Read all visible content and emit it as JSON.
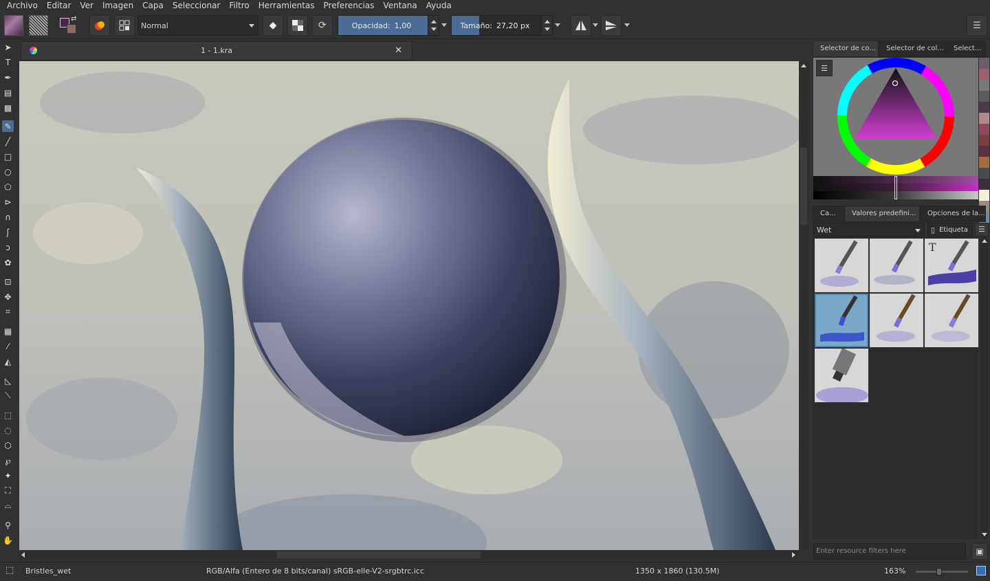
{
  "menu": [
    "Archivo",
    "Editar",
    "Ver",
    "Imagen",
    "Capa",
    "Seleccionar",
    "Filtro",
    "Herramientas",
    "Preferencias",
    "Ventana",
    "Ayuda"
  ],
  "toolbar": {
    "blend_mode": "Normal",
    "opacity_label": "Opacidad:",
    "opacity_value": "1,00",
    "opacity_fraction": 1.0,
    "size_label": "Tamaño:",
    "size_value": "27,20 px",
    "foreground_color": "#4a2848",
    "background_color": "#8d6a64"
  },
  "document": {
    "tab_title": "1 - 1.kra"
  },
  "dock": {
    "top_tabs": [
      "Selector de co...",
      "Selector de col...",
      "Select..."
    ],
    "bottom_tabs": [
      "Ca...",
      "Valores predefini...",
      "Opciones de la..."
    ],
    "preset_filter": "Wet",
    "tag_label": "Etiqueta",
    "search_placeholder": "Enter resource filters here",
    "palette_colors": [
      "#6d5a6b",
      "#a05f6f",
      "#7a7a7a",
      "#5b5b5b",
      "#4a3a48",
      "#b08a8a",
      "#8a4b5a",
      "#7a3f3f",
      "#5a2f3f",
      "#a36e3f",
      "#4a4a4a",
      "#3a2f3a",
      "#f5f0d7",
      "#9a8a7a",
      "#6a8aa6"
    ]
  },
  "status": {
    "brush": "Bristles_wet",
    "color_space": "RGB/Alfa (Entero de 8 bits/canal)  sRGB-elle-V2-srgbtrc.icc",
    "dimensions": "1350 x 1860 (130.5M)",
    "zoom": "163%"
  },
  "accent": "#4b6c97"
}
